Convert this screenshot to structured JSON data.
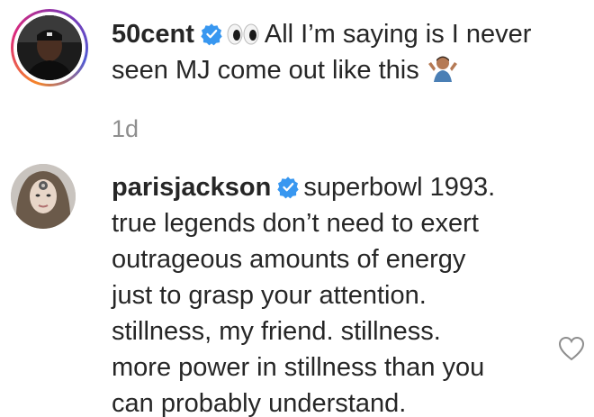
{
  "comments": [
    {
      "username": "50cent",
      "text_line1": "All I’m saying is I never",
      "text_line2": "seen MJ come out like this",
      "emoji_prefix": "eyes-emoji",
      "emoji_suffix": "shrug-emoji",
      "verified": true,
      "time": "1d"
    },
    {
      "username": "parisjackson",
      "lines": [
        "superbowl 1993.",
        "true legends don’t need to exert",
        "outrageous amounts of energy",
        "just to grasp your attention.",
        "stillness, my friend. stillness.",
        "more power in stillness than you",
        "can probably understand."
      ],
      "verified": true,
      "like_icon": "heart-outline-icon"
    }
  ],
  "colors": {
    "text": "#262626",
    "muted": "#8e8e8e",
    "verified_badge": "#3897f0"
  }
}
